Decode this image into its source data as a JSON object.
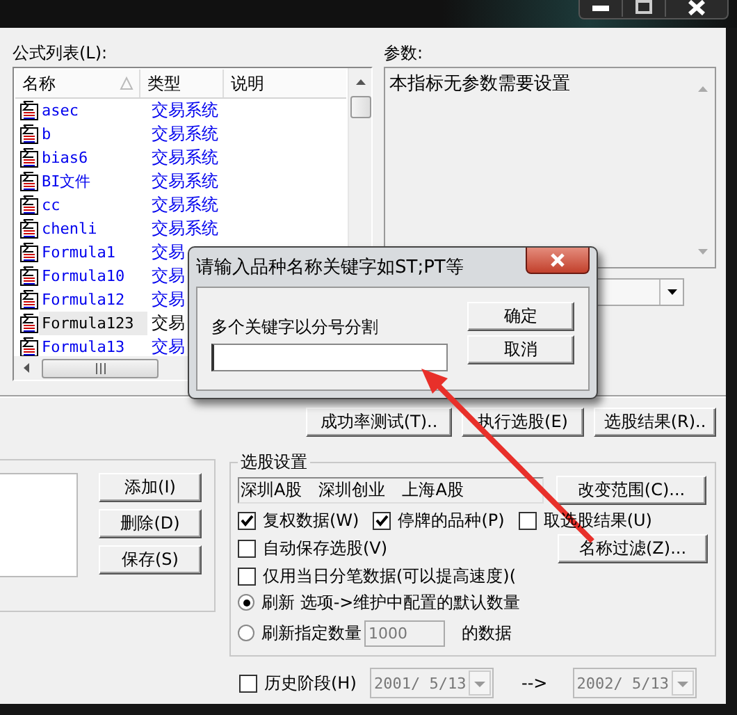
{
  "formula_list": {
    "label": "公式列表(L):",
    "columns": [
      "名称",
      "类型",
      "说明"
    ],
    "rows": [
      {
        "name": "asec",
        "type": "交易系统",
        "selected": false
      },
      {
        "name": "b",
        "type": "交易系统",
        "selected": false
      },
      {
        "name": "bias6",
        "type": "交易系统",
        "selected": false
      },
      {
        "name": "BI文件",
        "type": "交易系统",
        "selected": false
      },
      {
        "name": "cc",
        "type": "交易系统",
        "selected": false
      },
      {
        "name": "chenli",
        "type": "交易系统",
        "selected": false
      },
      {
        "name": "Formula1",
        "type": "交易",
        "selected": false
      },
      {
        "name": "Formula10",
        "type": "交易",
        "selected": false
      },
      {
        "name": "Formula12",
        "type": "交易",
        "selected": false
      },
      {
        "name": "Formula123",
        "type": "交易",
        "selected": true
      },
      {
        "name": "Formula13",
        "type": "交易",
        "selected": false
      }
    ]
  },
  "params": {
    "label": "参数:",
    "text": "本指标无参数需要设置"
  },
  "actions": [
    "成功率测试(T)..",
    "执行选股(E)",
    "选股结果(R).."
  ],
  "condition_buttons": [
    "添加(I)",
    "删除(D)",
    "保存(S)"
  ],
  "stock_settings": {
    "title": "选股设置",
    "markets": [
      "深圳A股",
      "深圳创业",
      "上海A股"
    ],
    "range_button": "改变范围(C)...",
    "filter_button": "名称过滤(Z)...",
    "row_checks": [
      {
        "label": "复权数据(W)",
        "checked": true
      },
      {
        "label": "停牌的品种(P)",
        "checked": true
      },
      {
        "label": "取选股结果(U)",
        "checked": false
      }
    ],
    "auto_save": {
      "label": "自动保存选股(V)",
      "checked": false
    },
    "tick_data": {
      "label": "仅用当日分笔数据(可以提高速度)(",
      "checked": false
    },
    "refresh_default": {
      "label": "刷新 选项->维护中配置的默认数量",
      "selected": true
    },
    "refresh_count": {
      "label": "刷新指定数量",
      "value": "1000",
      "suffix": "的数据",
      "selected": false
    }
  },
  "history": {
    "label": "历史阶段(H)",
    "checked": false,
    "from": "2001/ 5/13",
    "arrow": "-->",
    "to": "2002/ 5/13"
  },
  "dialog": {
    "title": "请输入品种名称关键字如ST;PT等",
    "prompt": "多个关键字以分号分割",
    "buttons": [
      "确定",
      "取消"
    ]
  }
}
